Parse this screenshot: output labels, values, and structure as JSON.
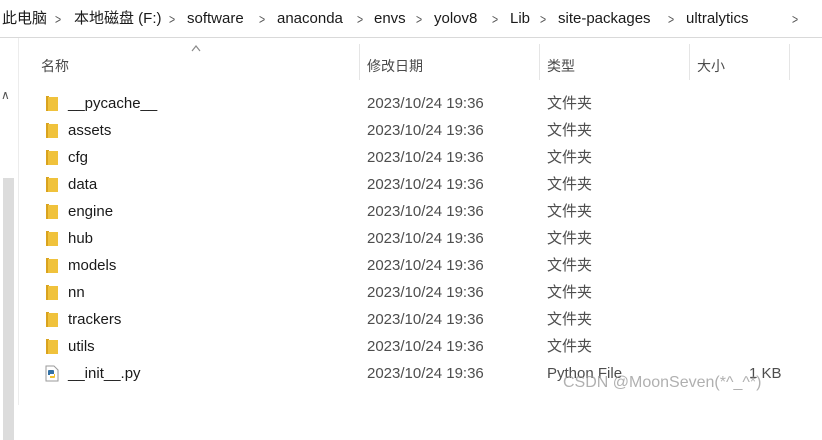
{
  "breadcrumb": {
    "items": [
      "此电脑",
      "本地磁盘 (F:)",
      "software",
      "anaconda",
      "envs",
      "yolov8",
      "Lib",
      "site-packages",
      "ultralytics"
    ]
  },
  "columns": {
    "name": "名称",
    "date": "修改日期",
    "type": "类型",
    "size": "大小"
  },
  "files": [
    {
      "name": "__pycache__",
      "date": "2023/10/24 19:36",
      "type": "文件夹",
      "size": "",
      "icon": "folder-icon"
    },
    {
      "name": "assets",
      "date": "2023/10/24 19:36",
      "type": "文件夹",
      "size": "",
      "icon": "folder-icon"
    },
    {
      "name": "cfg",
      "date": "2023/10/24 19:36",
      "type": "文件夹",
      "size": "",
      "icon": "folder-icon"
    },
    {
      "name": "data",
      "date": "2023/10/24 19:36",
      "type": "文件夹",
      "size": "",
      "icon": "folder-icon"
    },
    {
      "name": "engine",
      "date": "2023/10/24 19:36",
      "type": "文件夹",
      "size": "",
      "icon": "folder-icon"
    },
    {
      "name": "hub",
      "date": "2023/10/24 19:36",
      "type": "文件夹",
      "size": "",
      "icon": "folder-icon"
    },
    {
      "name": "models",
      "date": "2023/10/24 19:36",
      "type": "文件夹",
      "size": "",
      "icon": "folder-icon"
    },
    {
      "name": "nn",
      "date": "2023/10/24 19:36",
      "type": "文件夹",
      "size": "",
      "icon": "folder-icon"
    },
    {
      "name": "trackers",
      "date": "2023/10/24 19:36",
      "type": "文件夹",
      "size": "",
      "icon": "folder-icon"
    },
    {
      "name": "utils",
      "date": "2023/10/24 19:36",
      "type": "文件夹",
      "size": "",
      "icon": "folder-icon"
    },
    {
      "name": "__init__.py",
      "date": "2023/10/24 19:36",
      "type": "Python File",
      "size": "1 KB",
      "icon": "python-file-icon"
    }
  ],
  "watermark": "CSDN @MoonSeven(*^_^*)",
  "colors": {
    "folder": "#f0c23c",
    "folder_dark": "#d9a31e"
  }
}
